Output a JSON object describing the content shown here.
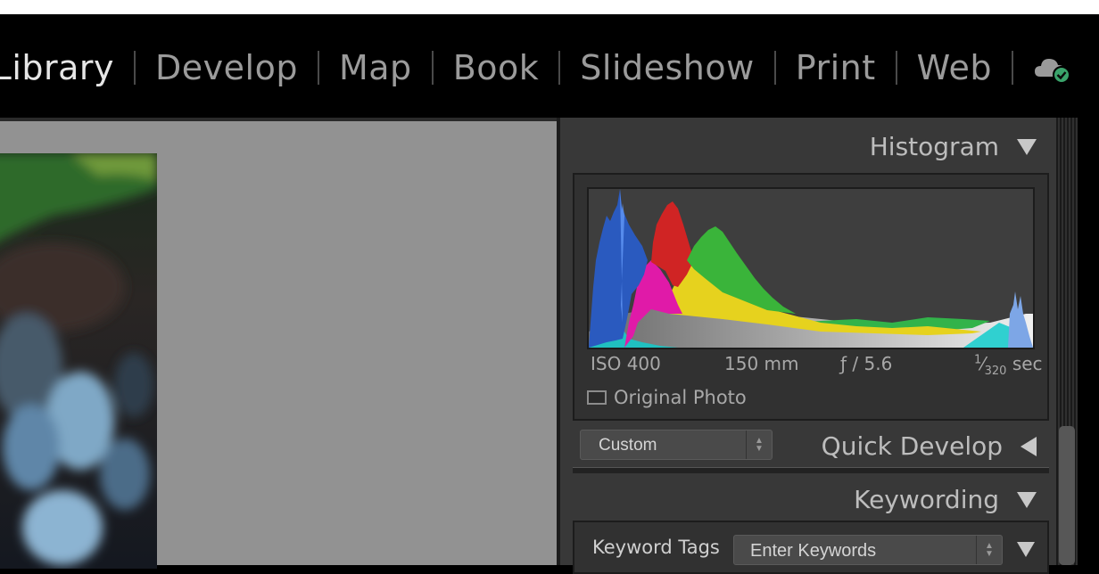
{
  "module_picker": {
    "items": [
      "Library",
      "Develop",
      "Map",
      "Book",
      "Slideshow",
      "Print",
      "Web"
    ],
    "active": "Library",
    "cloud_icon": "cloud-sync-icon",
    "sync_status_color": "#3aa36b"
  },
  "histogram": {
    "title": "Histogram",
    "iso": "ISO 400",
    "focal_length": "150 mm",
    "aperture": "ƒ / 5.6",
    "shutter_num": "1",
    "shutter_den": "320",
    "shutter_unit": "sec",
    "original_photo_label": "Original Photo",
    "original_photo_checked": false
  },
  "quick_develop": {
    "title": "Quick Develop",
    "preset_value": "Custom",
    "collapsed": true
  },
  "keywording": {
    "title": "Keywording",
    "keyword_tags_label": "Keyword Tags",
    "keyword_tags_value": "Enter Keywords"
  },
  "colors": {
    "accent_active": "#e6e6e6",
    "inactive": "#9b9b9b",
    "panel_bg": "#383838",
    "viewer_bg": "#929292"
  }
}
